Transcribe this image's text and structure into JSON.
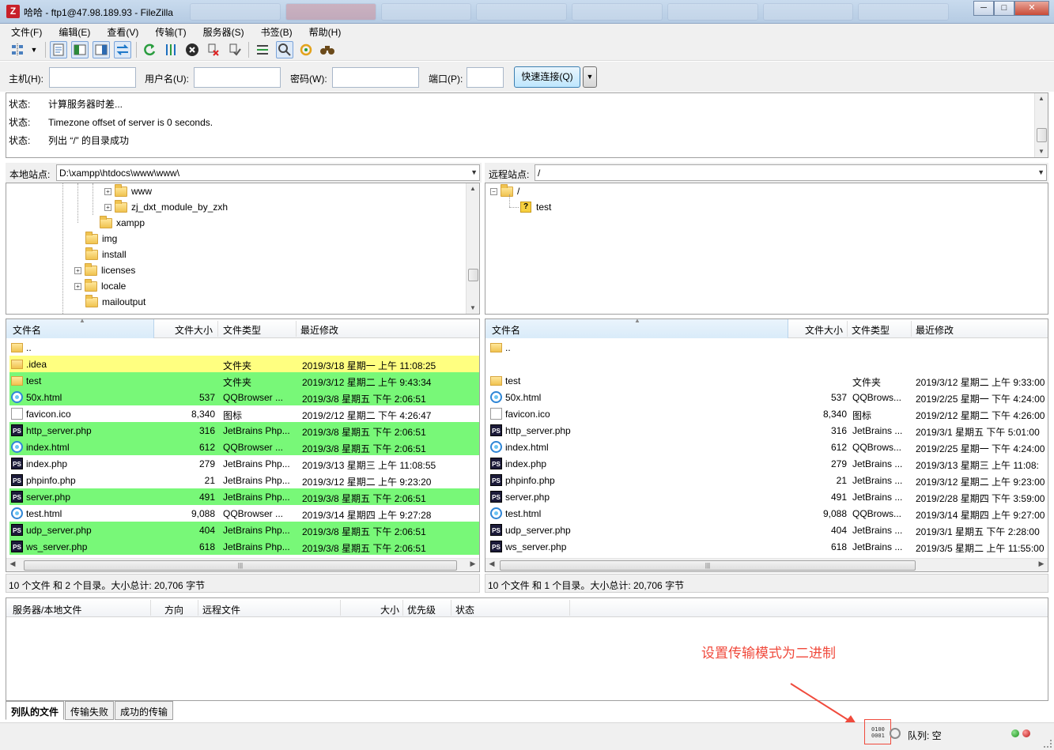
{
  "window": {
    "title": "哈哈 - ftp1@47.98.189.93 - FileZilla",
    "app_icon": "Z"
  },
  "menu": [
    "文件(F)",
    "编辑(E)",
    "查看(V)",
    "传输(T)",
    "服务器(S)",
    "书签(B)",
    "帮助(H)"
  ],
  "quickconnect": {
    "host_label": "主机(H):",
    "host_value": "",
    "user_label": "用户名(U):",
    "user_value": "",
    "pass_label": "密码(W):",
    "pass_value": "",
    "port_label": "端口(P):",
    "port_value": "",
    "connect_label": "快速连接(Q)"
  },
  "log": [
    {
      "k": "状态:",
      "v": "计算服务器时差..."
    },
    {
      "k": "状态:",
      "v": "Timezone offset of server is 0 seconds."
    },
    {
      "k": "状态:",
      "v": "列出 “/” 的目录成功"
    }
  ],
  "local": {
    "site_label": "本地站点:",
    "path": "D:\\xampp\\htdocs\\www\\www\\",
    "tree": [
      "www",
      "zj_dxt_module_by_zxh",
      "xampp",
      "img",
      "install",
      "licenses",
      "locale",
      "mailoutput"
    ],
    "columns": {
      "name": "文件名",
      "size": "文件大小",
      "type": "文件类型",
      "modified": "最近修改"
    },
    "files": [
      {
        "name": "..",
        "size": "",
        "type": "",
        "modified": ""
      },
      {
        "name": ".idea",
        "size": "",
        "type": "文件夹",
        "modified": "2019/3/18 星期一 上午 11:08:25"
      },
      {
        "name": "test",
        "size": "",
        "type": "文件夹",
        "modified": "2019/3/12 星期二 上午 9:43:34"
      },
      {
        "name": "50x.html",
        "size": "537",
        "type": "QQBrowser ...",
        "modified": "2019/3/8 星期五 下午 2:06:51"
      },
      {
        "name": "favicon.ico",
        "size": "8,340",
        "type": "图标",
        "modified": "2019/2/12 星期二 下午 4:26:47"
      },
      {
        "name": "http_server.php",
        "size": "316",
        "type": "JetBrains Php...",
        "modified": "2019/3/8 星期五 下午 2:06:51"
      },
      {
        "name": "index.html",
        "size": "612",
        "type": "QQBrowser ...",
        "modified": "2019/3/8 星期五 下午 2:06:51"
      },
      {
        "name": "index.php",
        "size": "279",
        "type": "JetBrains Php...",
        "modified": "2019/3/13 星期三 上午 11:08:55"
      },
      {
        "name": "phpinfo.php",
        "size": "21",
        "type": "JetBrains Php...",
        "modified": "2019/3/12 星期二 上午 9:23:20"
      },
      {
        "name": "server.php",
        "size": "491",
        "type": "JetBrains Php...",
        "modified": "2019/3/8 星期五 下午 2:06:51"
      },
      {
        "name": "test.html",
        "size": "9,088",
        "type": "QQBrowser ...",
        "modified": "2019/3/14 星期四 上午 9:27:28"
      },
      {
        "name": "udp_server.php",
        "size": "404",
        "type": "JetBrains Php...",
        "modified": "2019/3/8 星期五 下午 2:06:51"
      },
      {
        "name": "ws_server.php",
        "size": "618",
        "type": "JetBrains Php...",
        "modified": "2019/3/8 星期五 下午 2:06:51"
      }
    ],
    "status": "10 个文件 和 2 个目录。大小总计: 20,706 字节"
  },
  "remote": {
    "site_label": "远程站点:",
    "path": "/",
    "tree": [
      "/",
      "test"
    ],
    "columns": {
      "name": "文件名",
      "size": "文件大小",
      "type": "文件类型",
      "modified": "最近修改"
    },
    "files": [
      {
        "name": "..",
        "size": "",
        "type": "",
        "modified": ""
      },
      {
        "name": "test",
        "size": "",
        "type": "文件夹",
        "modified": "2019/3/12 星期二 上午 9:33:00"
      },
      {
        "name": "50x.html",
        "size": "537",
        "type": "QQBrows...",
        "modified": "2019/2/25 星期一 下午 4:24:00"
      },
      {
        "name": "favicon.ico",
        "size": "8,340",
        "type": "图标",
        "modified": "2019/2/12 星期二 下午 4:26:00"
      },
      {
        "name": "http_server.php",
        "size": "316",
        "type": "JetBrains ...",
        "modified": "2019/3/1 星期五 下午 5:01:00"
      },
      {
        "name": "index.html",
        "size": "612",
        "type": "QQBrows...",
        "modified": "2019/2/25 星期一 下午 4:24:00"
      },
      {
        "name": "index.php",
        "size": "279",
        "type": "JetBrains ...",
        "modified": "2019/3/13 星期三 上午 11:08:"
      },
      {
        "name": "phpinfo.php",
        "size": "21",
        "type": "JetBrains ...",
        "modified": "2019/3/12 星期二 上午 9:23:00"
      },
      {
        "name": "server.php",
        "size": "491",
        "type": "JetBrains ...",
        "modified": "2019/2/28 星期四 下午 3:59:00"
      },
      {
        "name": "test.html",
        "size": "9,088",
        "type": "QQBrows...",
        "modified": "2019/3/14 星期四 上午 9:27:00"
      },
      {
        "name": "udp_server.php",
        "size": "404",
        "type": "JetBrains ...",
        "modified": "2019/3/1 星期五 下午 2:28:00"
      },
      {
        "name": "ws_server.php",
        "size": "618",
        "type": "JetBrains ...",
        "modified": "2019/3/5 星期二 上午 11:55:00"
      }
    ],
    "status": "10 个文件 和 1 个目录。大小总计: 20,706 字节"
  },
  "queue": {
    "columns": {
      "server_local": "服务器/本地文件",
      "direction": "方向",
      "remote": "远程文件",
      "size": "大小",
      "priority": "优先级",
      "status": "状态"
    },
    "tabs": [
      "列队的文件",
      "传输失败",
      "成功的传输"
    ]
  },
  "annotation": "设置传输模式为二进制",
  "statusbar": {
    "binary_icon": "0100\n0001",
    "queue_label": "队列: 空"
  },
  "colors": {
    "transferred_green": "#78f878",
    "highlight_yellow": "#ffff80",
    "annotation_red": "#f04a3c"
  }
}
